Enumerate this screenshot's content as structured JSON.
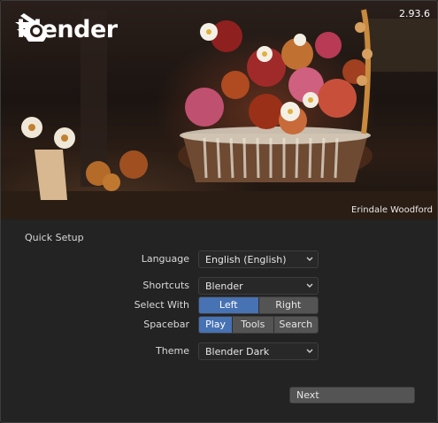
{
  "splash": {
    "logo_text": "blender",
    "version": "2.93.6",
    "credit": "Erindale Woodford"
  },
  "quick_setup": {
    "title": "Quick Setup",
    "language": {
      "label": "Language",
      "value": "English (English)"
    },
    "shortcuts": {
      "label": "Shortcuts",
      "value": "Blender"
    },
    "select_with": {
      "label": "Select With",
      "options": [
        "Left",
        "Right"
      ],
      "selected": "Left"
    },
    "spacebar": {
      "label": "Spacebar",
      "options": [
        "Play",
        "Tools",
        "Search"
      ],
      "selected": "Play"
    },
    "theme": {
      "label": "Theme",
      "value": "Blender Dark"
    },
    "next_label": "Next"
  },
  "colors": {
    "accent": "#4772b3",
    "panel_bg": "#232323",
    "widget_bg": "#282828",
    "button_bg": "#545454"
  }
}
